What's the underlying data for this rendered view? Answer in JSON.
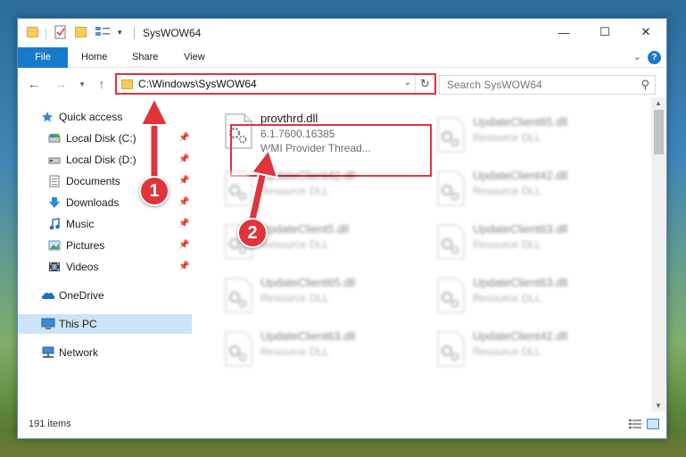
{
  "window": {
    "title": "SysWOW64",
    "minimize_glyph": "—",
    "maximize_glyph": "☐",
    "close_glyph": "✕"
  },
  "quick_access_toolbar": {
    "dropdown_glyph": "▾"
  },
  "ribbon": {
    "tabs": [
      {
        "label": "File"
      },
      {
        "label": "Home"
      },
      {
        "label": "Share"
      },
      {
        "label": "View"
      }
    ],
    "expand_glyph": "⌄",
    "help_glyph": "?"
  },
  "navigation": {
    "back_glyph": "←",
    "forward_glyph": "→",
    "recent_glyph": "▾",
    "up_glyph": "↑",
    "address": "C:\\Windows\\SysWOW64",
    "address_dropdown_glyph": "⌄",
    "refresh_glyph": "↻",
    "search_placeholder": "Search SysWOW64",
    "search_glyph": "⚲"
  },
  "sidebar": {
    "pin_glyph": "📌",
    "items": [
      {
        "label": "Quick access",
        "icon": "star-icon",
        "pinned": false
      },
      {
        "label": "Local Disk (C:)",
        "icon": "drive-icon",
        "pinned": true
      },
      {
        "label": "Local Disk (D:)",
        "icon": "drive-icon",
        "pinned": true
      },
      {
        "label": "Documents",
        "icon": "documents-icon",
        "pinned": true
      },
      {
        "label": "Downloads",
        "icon": "download-icon",
        "pinned": true
      },
      {
        "label": "Music",
        "icon": "music-icon",
        "pinned": true
      },
      {
        "label": "Pictures",
        "icon": "pictures-icon",
        "pinned": true
      },
      {
        "label": "Videos",
        "icon": "videos-icon",
        "pinned": true
      },
      {
        "label": "OneDrive",
        "icon": "cloud-icon",
        "pinned": false
      },
      {
        "label": "This PC",
        "icon": "computer-icon",
        "pinned": false,
        "selected": true
      },
      {
        "label": "Network",
        "icon": "network-icon",
        "pinned": false
      }
    ]
  },
  "files": {
    "highlighted": {
      "name": "provthrd.dll",
      "version": "6.1.7600.16385",
      "description": "WMI Provider Thread..."
    },
    "left_column": [
      {
        "name": "UpdateClient42.dll",
        "type": "Resource DLL"
      },
      {
        "name": "UpdateClient5.dll",
        "type": "Resource DLL"
      },
      {
        "name": "UpdateClient65.dll",
        "type": "Resource DLL"
      },
      {
        "name": "UpdateClient63.dll",
        "type": "Resource DLL"
      }
    ],
    "right_column": [
      {
        "name": "UpdateClient65.dll",
        "type": "Resource DLL"
      },
      {
        "name": "UpdateClient42.dll",
        "type": "Resource DLL"
      },
      {
        "name": "UpdateClient63.dll",
        "type": "Resource DLL"
      },
      {
        "name": "UpdateClient63.dll",
        "type": "Resource DLL"
      },
      {
        "name": "UpdateClient42.dll",
        "type": "Resource DLL"
      }
    ]
  },
  "scrollbar": {
    "up_glyph": "▲",
    "down_glyph": "▼"
  },
  "status": {
    "item_count": "191 items"
  },
  "annotations": {
    "step1": "1",
    "step2": "2",
    "color": "#e0333a"
  }
}
